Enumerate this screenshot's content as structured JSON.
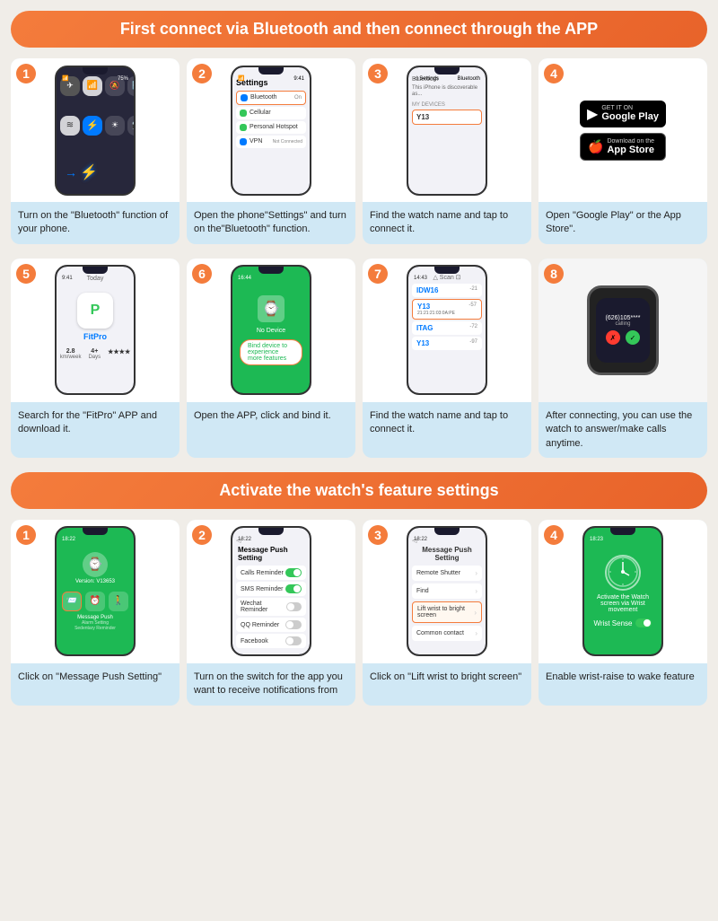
{
  "section1": {
    "header": "First connect via Bluetooth and then connect through the APP",
    "steps": [
      {
        "number": "1",
        "description": "Turn on the \"Bluetooth\" function of your phone."
      },
      {
        "number": "2",
        "description": "Open the phone\"Settings\" and turn on the\"Bluetooth\" function."
      },
      {
        "number": "3",
        "description": "Find the watch name and tap to connect it."
      },
      {
        "number": "4",
        "description": "Open \"Google Play\" or the App Store\"."
      },
      {
        "number": "5",
        "description": "Search for the \"FitPro\" APP and download it."
      },
      {
        "number": "6",
        "description": "Open the APP, click and bind it."
      },
      {
        "number": "7",
        "description": "Find the watch name and tap to connect it."
      },
      {
        "number": "8",
        "description": "After connecting, you can use the watch to answer/make calls anytime."
      }
    ],
    "google_play": "GET IT ON",
    "google_play_store": "Google Play",
    "app_store_download": "Download on the",
    "app_store": "App Store",
    "bluetooth_label": "Bluetooth",
    "bluetooth_on": "On",
    "settings_title": "Settings",
    "airplane_mode": "Airplane Mode",
    "cellular": "Cellular",
    "hotspot": "Personal Hotspot",
    "vpn": "VPN",
    "vpn_status": "Not Connected",
    "device_name": "Y13",
    "fitpro_label": "FitPro",
    "no_device": "No Device",
    "bind_device": "Bind device to experience more features",
    "idw16_label": "IDW16",
    "itag_label": "ITAG",
    "y13_label": "Y13",
    "call_number": "(626)105****",
    "calling_label": "calling"
  },
  "section2": {
    "header": "Activate the watch's feature settings",
    "steps": [
      {
        "number": "1",
        "description": "Click on \"Message Push Setting\""
      },
      {
        "number": "2",
        "description": "Turn on the switch for the app you want to receive notifications from"
      },
      {
        "number": "3",
        "description": "Click on \"Lift wrist to bright screen\""
      },
      {
        "number": "4",
        "description": "Enable wrist-raise to wake feature"
      }
    ],
    "version": "Version: V13653",
    "msg_push_setting": "Message Push Setting",
    "calls_reminder": "Calls Reminder",
    "sms_reminder": "SMS Reminder",
    "wechat_reminder": "Wechat Reminder",
    "qq_reminder": "QQ Reminder",
    "facebook": "Facebook",
    "message_push": "Message Push Setting",
    "remote_shutter": "Remote Shutter",
    "find": "Find",
    "lift_wrist": "Lift wrist to bright screen",
    "common_contact": "Common contact",
    "sedentary_reminder": "Sedentary Reminder",
    "wrist_sense": "Wrist Sense",
    "alarm_setting": "Alarm Setting"
  }
}
